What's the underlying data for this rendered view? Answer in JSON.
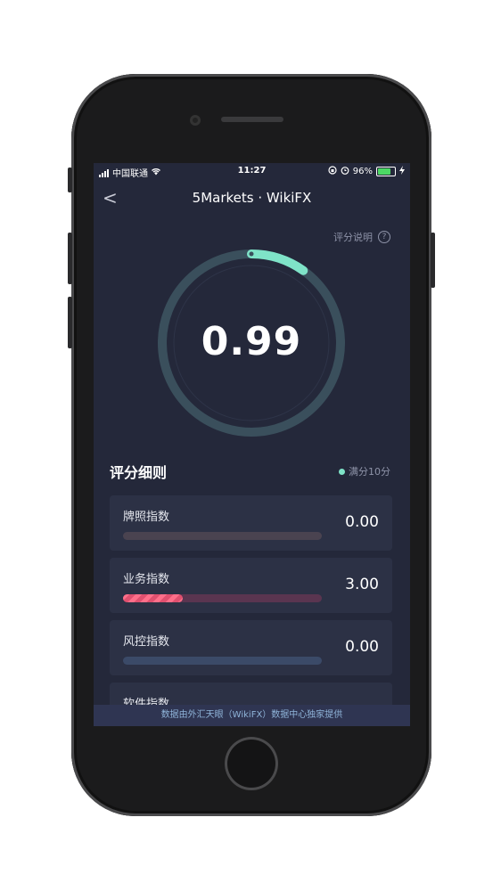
{
  "status_bar": {
    "carrier": "中国联通",
    "time": "11:27",
    "battery": "96%"
  },
  "nav": {
    "back_glyph": "<",
    "title": "5Markets · WikiFX"
  },
  "explain": {
    "label": "评分说明",
    "icon_glyph": "?"
  },
  "gauge": {
    "score": "0.99",
    "progress_fraction": 0.099,
    "colors": {
      "ring": "#3a4f5c",
      "progress": "#7fe3c8"
    }
  },
  "details": {
    "title": "评分细则",
    "full_mark": "满分10分",
    "items": [
      {
        "name": "牌照指数",
        "value": "0.00",
        "fraction": 0.0,
        "track": "#4a4350"
      },
      {
        "name": "业务指数",
        "value": "3.00",
        "fraction": 0.3,
        "track": "#5a3550"
      },
      {
        "name": "风控指数",
        "value": "0.00",
        "fraction": 0.0,
        "track": "#3b4a68"
      },
      {
        "name": "软件指数",
        "value": "",
        "fraction": 0.0,
        "track": "#3b4a68"
      }
    ]
  },
  "footer": {
    "text": "数据由外汇天眼（WikiFX）数据中心独家提供"
  }
}
